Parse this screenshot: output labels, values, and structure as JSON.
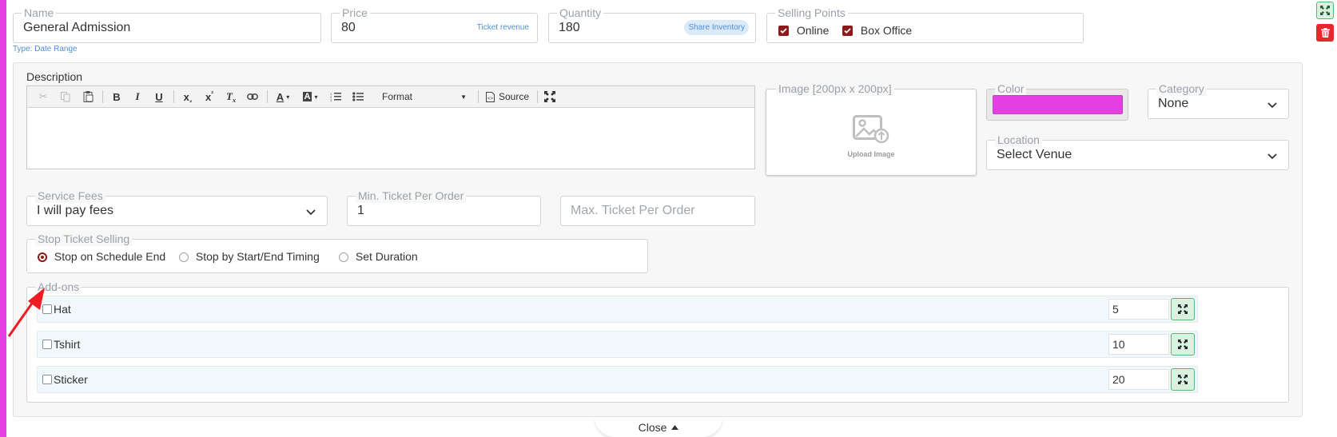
{
  "ticket": {
    "name_label": "Name",
    "name_value": "General Admission",
    "type_hint": "Type: Date Range",
    "price_label": "Price",
    "price_value": "80",
    "price_link": "Ticket revenue",
    "quantity_label": "Quantity",
    "quantity_value": "180",
    "quantity_link": "Share Inventory",
    "selling_points_label": "Selling Points",
    "selling_points": [
      {
        "label": "Online",
        "checked": true
      },
      {
        "label": "Box Office",
        "checked": true
      }
    ]
  },
  "description": {
    "label": "Description",
    "toolbar": {
      "format_label": "Format",
      "source_label": "Source"
    }
  },
  "image": {
    "label": "Image [200px x 200px]",
    "upload_label": "Upload Image"
  },
  "color": {
    "label": "Color",
    "value": "#e53ee3"
  },
  "category": {
    "label": "Category",
    "value": "None"
  },
  "location": {
    "label": "Location",
    "value": "Select Venue"
  },
  "service_fees": {
    "label": "Service Fees",
    "value": "I will pay fees"
  },
  "min_ticket": {
    "label": "Min. Ticket Per Order",
    "value": "1"
  },
  "max_ticket": {
    "placeholder": "Max. Ticket Per Order"
  },
  "stop_selling": {
    "label": "Stop Ticket Selling",
    "options": [
      {
        "label": "Stop on Schedule End",
        "selected": true
      },
      {
        "label": "Stop by Start/End Timing",
        "selected": false
      },
      {
        "label": "Set Duration",
        "selected": false
      }
    ]
  },
  "addons": {
    "label": "Add-ons",
    "items": [
      {
        "name": "Hat",
        "qty": "5"
      },
      {
        "name": "Tshirt",
        "qty": "10"
      },
      {
        "name": "Sticker",
        "qty": "20"
      }
    ]
  },
  "footer": {
    "close_label": "Close"
  },
  "colors": {
    "accent_pink": "#e53ee3",
    "checkbox_dark_red": "#8b1a1a",
    "delete_red": "#e8272a",
    "expand_green": "#56b874"
  }
}
